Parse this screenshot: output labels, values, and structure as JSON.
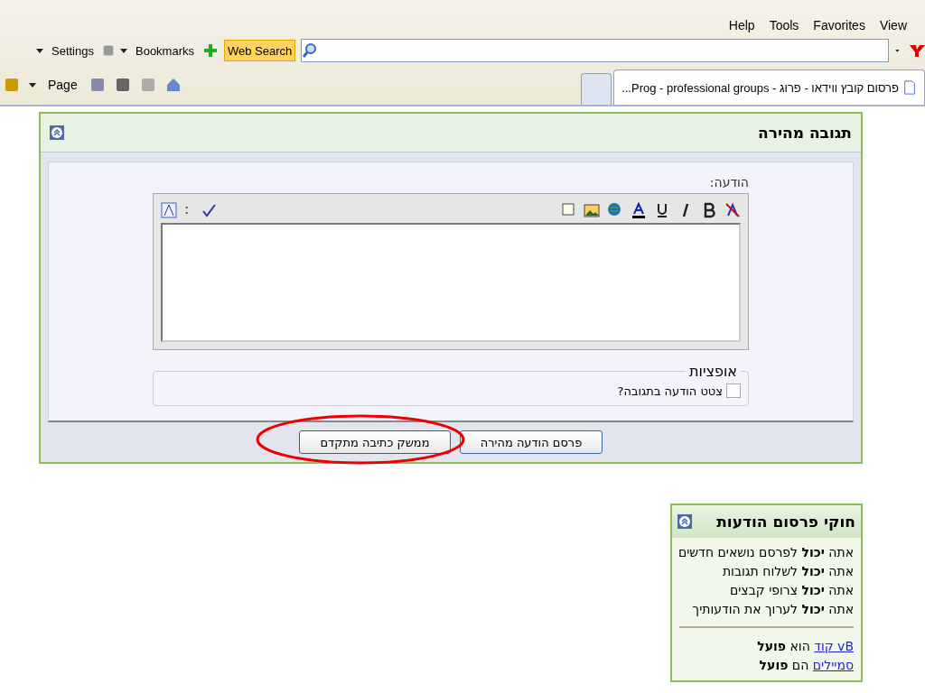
{
  "menu_bar": [
    "View",
    "Favorites",
    "Tools",
    "Help"
  ],
  "toolbar": {
    "settings": "Settings",
    "bookmarks": "Bookmarks",
    "search_button": "Web Search"
  },
  "command_bar": {
    "page": "Page"
  },
  "tabs": [
    {
      "label": "פרסום קובץ ווידאו - פרוג - Prog - professional groups...",
      "selected": true
    },
    {
      "selected": false
    }
  ],
  "quick_reply": {
    "title": "תגובה מהירה",
    "message_label": "הודעה:",
    "options": {
      "legend": "אופציות",
      "quote": {
        "label": "צטט הודעה בתגובה?",
        "checked": false
      }
    },
    "buttons": [
      {
        "label": "פרסם הודעה מהירה",
        "kind": "primary"
      },
      {
        "label": "ממשק כתיבה מתקדם",
        "kind": "secondary"
      }
    ],
    "highlight": {
      "kind": "ellipse"
    }
  },
  "posting_rules": {
    "title": "חוקי פרסום הודעות",
    "rules": [
      "אתה **יכול** לפרסם נושאים חדשים",
      "אתה **יכול** לשלוח תגובות",
      "אתה **יכול** צרופי קבצים",
      "אתה **יכול** לערוך את הודעותיך"
    ],
    "codes": [
      {
        "link": "vB קוד",
        "text": "הוא **פועל**"
      },
      {
        "link": "סמיילים",
        "text": "הם **פועל**"
      }
    ]
  }
}
